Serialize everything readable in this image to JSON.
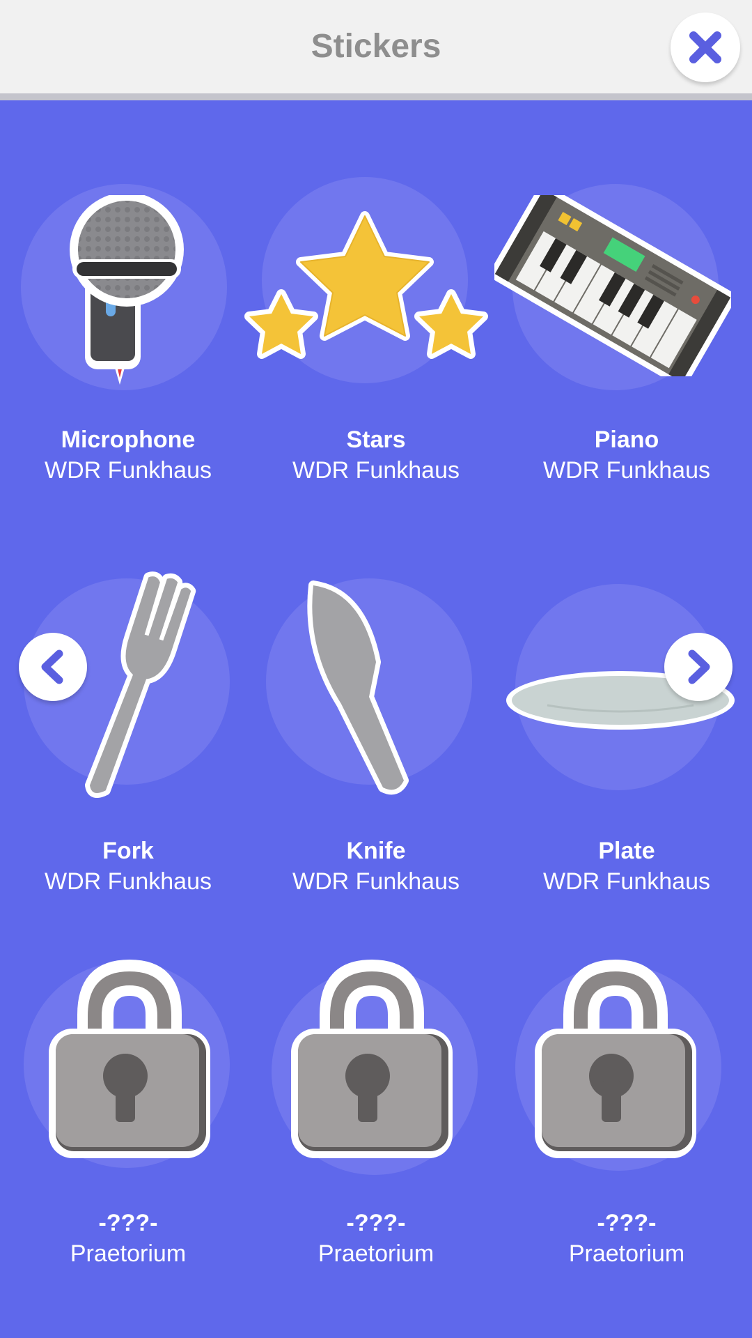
{
  "header": {
    "title": "Stickers"
  },
  "colors": {
    "background": "#5f68eb",
    "accent": "#5a5fe0",
    "circle": "#7177ee"
  },
  "stickers": [
    {
      "name": "Microphone",
      "place": "WDR Funkhaus",
      "icon": "microphone-icon",
      "locked": false
    },
    {
      "name": "Stars",
      "place": "WDR Funkhaus",
      "icon": "stars-icon",
      "locked": false
    },
    {
      "name": "Piano",
      "place": "WDR Funkhaus",
      "icon": "piano-icon",
      "locked": false
    },
    {
      "name": "Fork",
      "place": "WDR Funkhaus",
      "icon": "fork-icon",
      "locked": false
    },
    {
      "name": "Knife",
      "place": "WDR Funkhaus",
      "icon": "knife-icon",
      "locked": false
    },
    {
      "name": "Plate",
      "place": "WDR Funkhaus",
      "icon": "plate-icon",
      "locked": false
    },
    {
      "name": "-???-",
      "place": "Praetorium",
      "icon": "padlock-icon",
      "locked": true
    },
    {
      "name": "-???-",
      "place": "Praetorium",
      "icon": "padlock-icon",
      "locked": true
    },
    {
      "name": "-???-",
      "place": "Praetorium",
      "icon": "padlock-icon",
      "locked": true
    }
  ],
  "navigation": {
    "prev_icon": "chevron-left-icon",
    "next_icon": "chevron-right-icon",
    "close_icon": "close-icon"
  }
}
